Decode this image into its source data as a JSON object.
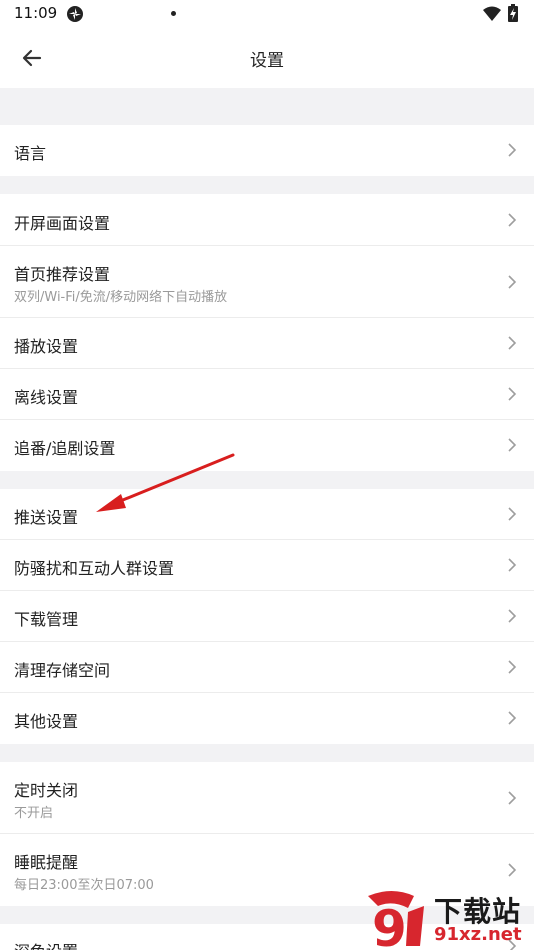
{
  "status_bar": {
    "time": "11:09"
  },
  "header": {
    "title": "设置",
    "back_icon": "arrow-left-icon"
  },
  "groups": [
    {
      "items": [
        {
          "title": "语言"
        }
      ]
    },
    {
      "items": [
        {
          "title": "开屏画面设置"
        },
        {
          "title": "首页推荐设置",
          "subtitle": "双列/Wi-Fi/免流/移动网络下自动播放"
        },
        {
          "title": "播放设置"
        },
        {
          "title": "离线设置"
        },
        {
          "title": "追番/追剧设置"
        }
      ]
    },
    {
      "items": [
        {
          "title": "推送设置"
        },
        {
          "title": "防骚扰和互动人群设置"
        },
        {
          "title": "下载管理"
        },
        {
          "title": "清理存储空间"
        },
        {
          "title": "其他设置"
        }
      ]
    },
    {
      "items": [
        {
          "title": "定时关闭",
          "subtitle": "不开启"
        },
        {
          "title": "睡眠提醒",
          "subtitle": "每日23:00至次日07:00"
        }
      ]
    },
    {
      "items": [
        {
          "title": "深色设置"
        }
      ]
    }
  ],
  "watermark": {
    "line1": "下载站",
    "line2": "91xz.net",
    "mark": "9"
  },
  "colors": {
    "annotation_arrow": "#d81e1e",
    "separator": "#f2f2f4",
    "watermark_red": "#d7262e"
  }
}
